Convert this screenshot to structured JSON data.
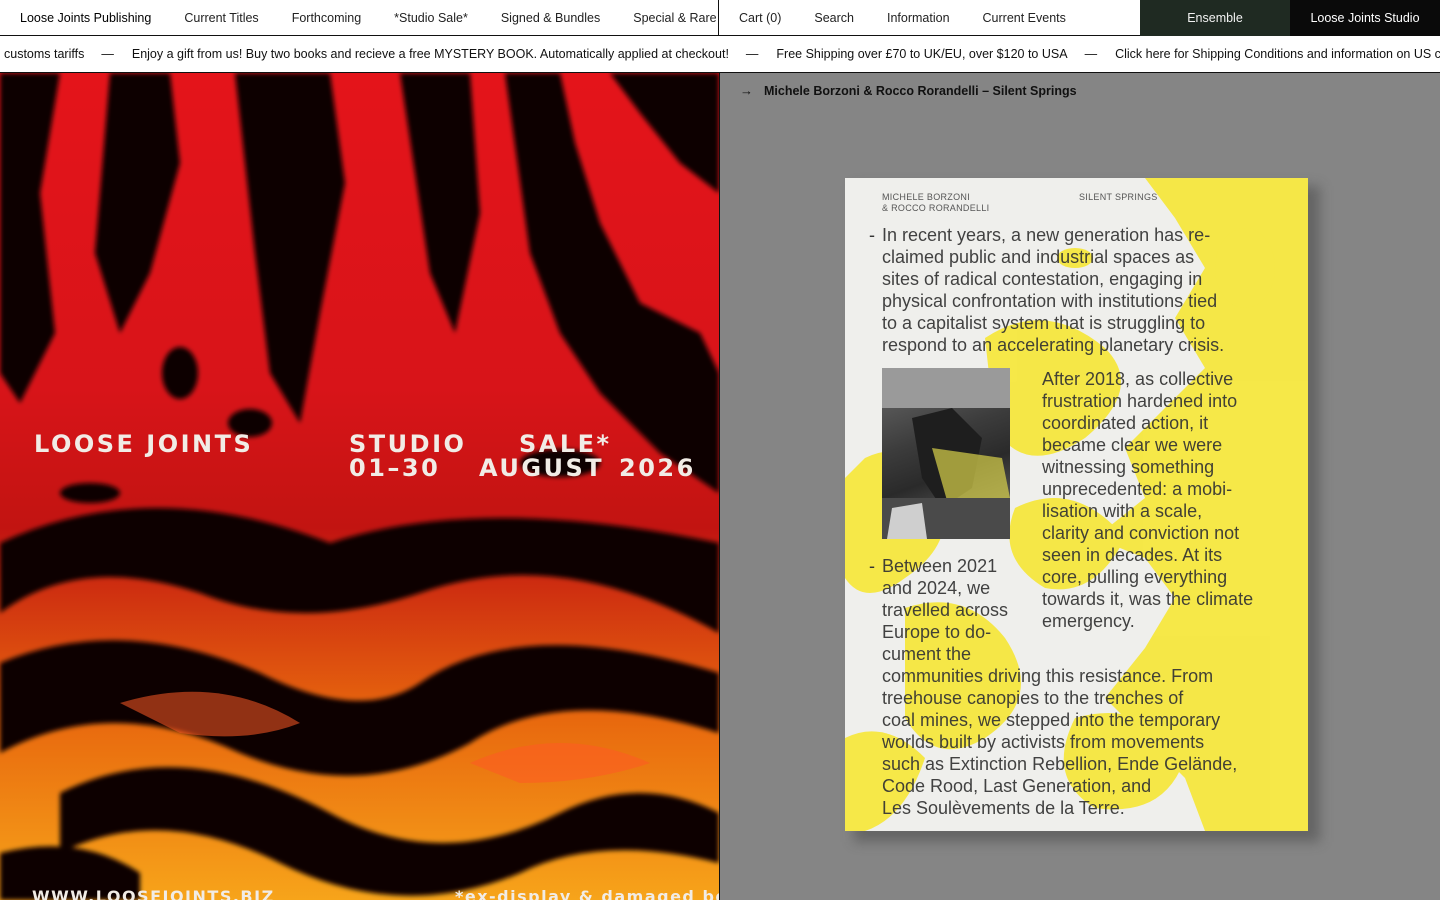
{
  "nav": {
    "brand": "Loose Joints Publishing",
    "left_links": [
      "Current Titles",
      "Forthcoming",
      "*Studio Sale*",
      "Signed & Bundles",
      "Special & Rare"
    ],
    "right_links": [
      "Cart (0)",
      "Search",
      "Information",
      "Current Events"
    ],
    "ensemble": "Ensemble",
    "studio": "Loose Joints Studio"
  },
  "ticker": {
    "items": [
      "customs tariffs",
      "Enjoy a gift from us! Buy two books and recieve a free MYSTERY BOOK. Automatically applied at checkout!",
      "Free Shipping over £70 to UK/EU, over $120 to USA",
      "Click here for Shipping Conditions and information on US customs tariffs"
    ],
    "separator": "—"
  },
  "poster": {
    "brand": "LOOSE JOINTS",
    "studio": "STUDIO",
    "sale": "SALE*",
    "dates": "01–30",
    "month": "AUGUST",
    "year": "2026",
    "url": "WWW.LOOSEJOINTS.BIZ",
    "footnote": "*ex-display & damaged books"
  },
  "product": {
    "breadcrumb": "Michele Borzoni & Rocco Rorandelli – Silent Springs",
    "cover": {
      "authors_line1": "MICHELE BORZONI",
      "authors_line2": "& ROCCO RORANDELLI",
      "title": "SILENT SPRINGS",
      "dash": "-",
      "para1_lines": [
        "In recent years, a new generation has re-",
        "claimed public and industrial spaces as",
        "sites of radical contestation, engaging in",
        "physical confrontation with institutions tied",
        "to a capitalist system that is struggling to",
        "respond to an accelerating planetary crisis."
      ],
      "para2_lines": [
        "After 2018, as collective",
        "frustration hardened into",
        "coordinated action, it",
        "became clear we were",
        "witnessing something",
        "unprecedented: a mobi-",
        "lisation with a scale,",
        "clarity and conviction not",
        "seen in decades. At its",
        "core, pulling everything",
        "towards it, was the climate",
        "emergency."
      ],
      "para3_lines": [
        "Between 2021",
        "and 2024, we",
        "travelled across",
        "Europe to do-",
        "cument the",
        "communities driving this resistance. From",
        "treehouse canopies to the trenches of",
        "coal mines, we stepped into the temporary",
        "worlds built by activists from movements",
        "such as Extinction Rebellion, Ende Gelände,",
        "Code Rood, Last Generation, and",
        "Les Soulèvements de la Terre."
      ]
    }
  }
}
